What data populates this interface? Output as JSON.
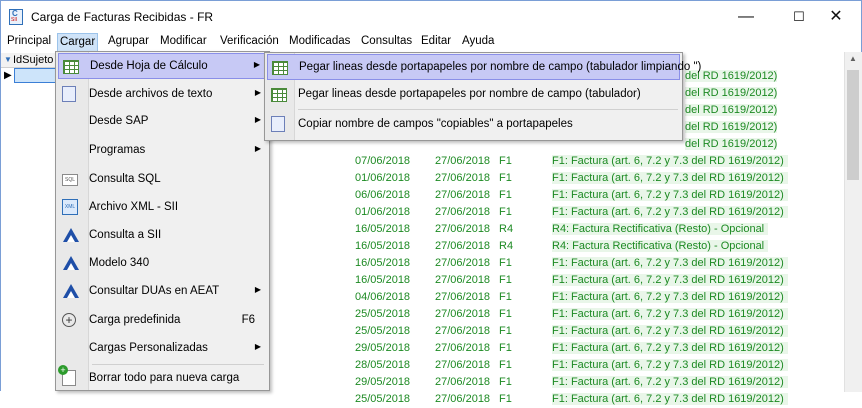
{
  "window": {
    "title": "Carga de Facturas Recibidas - FR",
    "minimize": "—",
    "maximize": "☐",
    "close": "✕"
  },
  "menubar": [
    "Principal",
    "Cargar",
    "Agrupar",
    "Modificar",
    "Verificación",
    "Modificadas",
    "Consultas",
    "Editar",
    "Ayuda"
  ],
  "grid": {
    "column_header": "IdSujeto",
    "rows": [
      {
        "d1": "07/06/2018",
        "d2": "27/06/2018",
        "t": "F1",
        "desc": "F1: Factura (art. 6, 7.2 y 7.3 del RD 1619/2012)"
      },
      {
        "d1": "01/06/2018",
        "d2": "27/06/2018",
        "t": "F1",
        "desc": "F1: Factura (art. 6, 7.2 y 7.3 del RD 1619/2012)"
      },
      {
        "d1": "06/06/2018",
        "d2": "27/06/2018",
        "t": "F1",
        "desc": "F1: Factura (art. 6, 7.2 y 7.3 del RD 1619/2012)"
      },
      {
        "d1": "01/06/2018",
        "d2": "27/06/2018",
        "t": "F1",
        "desc": "F1: Factura (art. 6, 7.2 y 7.3 del RD 1619/2012)"
      },
      {
        "d1": "16/05/2018",
        "d2": "27/06/2018",
        "t": "R4",
        "desc": "R4: Factura Rectificativa (Resto) - Opcional"
      },
      {
        "d1": "16/05/2018",
        "d2": "27/06/2018",
        "t": "R4",
        "desc": "R4: Factura Rectificativa (Resto) - Opcional"
      },
      {
        "d1": "16/05/2018",
        "d2": "27/06/2018",
        "t": "F1",
        "desc": "F1: Factura (art. 6, 7.2 y 7.3 del RD 1619/2012)"
      },
      {
        "d1": "16/05/2018",
        "d2": "27/06/2018",
        "t": "F1",
        "desc": "F1: Factura (art. 6, 7.2 y 7.3 del RD 1619/2012)"
      },
      {
        "d1": "04/06/2018",
        "d2": "27/06/2018",
        "t": "F1",
        "desc": "F1: Factura (art. 6, 7.2 y 7.3 del RD 1619/2012)"
      },
      {
        "d1": "25/05/2018",
        "d2": "27/06/2018",
        "t": "F1",
        "desc": "F1: Factura (art. 6, 7.2 y 7.3 del RD 1619/2012)"
      },
      {
        "d1": "25/05/2018",
        "d2": "27/06/2018",
        "t": "F1",
        "desc": "F1: Factura (art. 6, 7.2 y 7.3 del RD 1619/2012)"
      },
      {
        "d1": "29/05/2018",
        "d2": "27/06/2018",
        "t": "F1",
        "desc": "F1: Factura (art. 6, 7.2 y 7.3 del RD 1619/2012)"
      },
      {
        "d1": "28/05/2018",
        "d2": "27/06/2018",
        "t": "F1",
        "desc": "F1: Factura (art. 6, 7.2 y 7.3 del RD 1619/2012)"
      },
      {
        "d1": "29/05/2018",
        "d2": "27/06/2018",
        "t": "F1",
        "desc": "F1: Factura (art. 6, 7.2 y 7.3 del RD 1619/2012)"
      },
      {
        "d1": "25/05/2018",
        "d2": "27/06/2018",
        "t": "F1",
        "desc": "F1: Factura (art. 6, 7.2 y 7.3 del RD 1619/2012)"
      }
    ],
    "partial_desc": [
      "del RD 1619/2012)",
      "del RD 1619/2012)",
      "del RD 1619/2012)",
      "del RD 1619/2012)",
      "del RD 1619/2012)"
    ]
  },
  "cargar_menu": [
    {
      "label": "Desde Hoja de Cálculo",
      "icon": "spreadsheet-icon",
      "submenu": true,
      "highlighted": true
    },
    {
      "label": "Desde archivos de texto",
      "icon": "text-file-icon",
      "submenu": true
    },
    {
      "label": "Desde SAP",
      "icon": "",
      "submenu": true
    },
    {
      "label": "Programas",
      "icon": "",
      "submenu": true
    },
    {
      "label": "Consulta SQL",
      "icon": "sql-icon"
    },
    {
      "label": "Archivo XML - SII",
      "icon": "xml-icon"
    },
    {
      "label": "Consulta a SII",
      "icon": "aeat-icon"
    },
    {
      "label": "Modelo 340",
      "icon": "aeat-icon"
    },
    {
      "label": "Consultar DUAs en AEAT",
      "icon": "aeat-icon",
      "submenu": true
    },
    {
      "label": "Carga predefinida",
      "icon": "add-circle-icon",
      "shortcut": "F6"
    },
    {
      "label": "Cargas Personalizadas",
      "icon": "",
      "submenu": true
    },
    {
      "label": "Borrar todo para nueva carga",
      "icon": "new-document-icon"
    }
  ],
  "submenu": [
    {
      "label": "Pegar lineas desde portapapeles por nombre de campo (tabulador limpiando \")",
      "highlighted": true
    },
    {
      "label": "Pegar lineas desde portapapeles por nombre de campo (tabulador)"
    },
    {
      "label": "Copiar nombre de campos \"copiables\" a portapapeles"
    }
  ],
  "colors": {
    "accent": "#c7c9f5",
    "text_green": "#1d8a23",
    "menu_active": "#cfe3f8"
  }
}
